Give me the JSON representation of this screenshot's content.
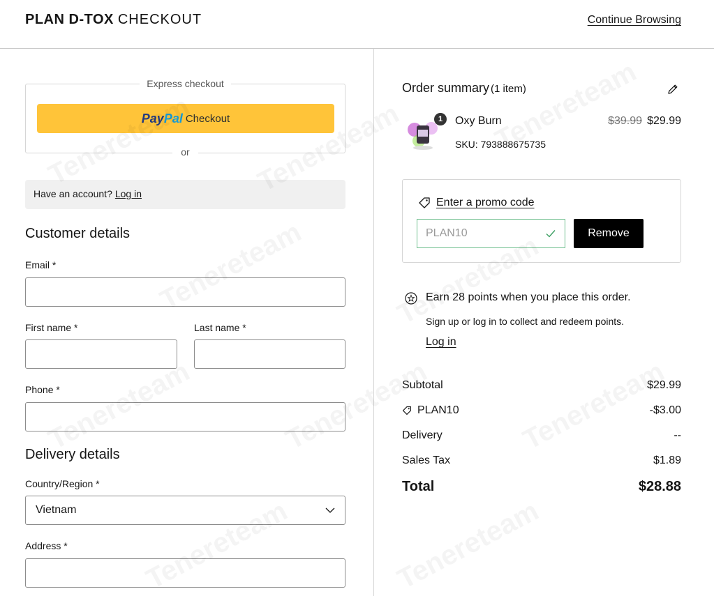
{
  "header": {
    "brand_name": "PLAN D-TOX",
    "brand_sub": "CHECKOUT",
    "continue_label": "Continue Browsing"
  },
  "express": {
    "title": "Express checkout",
    "paypal_pay": "Pay",
    "paypal_pal": "Pal",
    "paypal_text": "Checkout",
    "or": "or"
  },
  "account": {
    "prompt": "Have an account?",
    "login": "Log in"
  },
  "customer": {
    "title": "Customer details",
    "email_label": "Email *",
    "email_value": "",
    "first_name_label": "First name *",
    "first_name_value": "",
    "last_name_label": "Last name *",
    "last_name_value": "",
    "phone_label": "Phone *",
    "phone_value": ""
  },
  "delivery": {
    "title": "Delivery details",
    "country_label": "Country/Region *",
    "country_value": "Vietnam",
    "address_label": "Address *",
    "address_value": ""
  },
  "summary": {
    "title": "Order summary",
    "count": "(1 item)",
    "item": {
      "quantity": "1",
      "name": "Oxy Burn",
      "sku": "SKU: 793888675735",
      "price_old": "$39.99",
      "price_new": "$29.99"
    },
    "promo": {
      "link": "Enter a promo code",
      "code": "PLAN10",
      "remove": "Remove"
    },
    "points": {
      "title": "Earn 28 points when you place this order.",
      "sub": "Sign up or log in to collect and redeem points.",
      "login": "Log in"
    },
    "totals": {
      "subtotal_label": "Subtotal",
      "subtotal_value": "$29.99",
      "discount_label": "PLAN10",
      "discount_value": "-$3.00",
      "delivery_label": "Delivery",
      "delivery_value": "--",
      "tax_label": "Sales Tax",
      "tax_value": "$1.89",
      "total_label": "Total",
      "total_value": "$28.88"
    }
  },
  "colors": {
    "paypal_yellow": "#ffc439",
    "paypal_blue_dark": "#253b80",
    "paypal_blue_light": "#179bd7",
    "promo_valid_green": "#6fbf8e",
    "remove_button_bg": "#000000"
  },
  "watermark": "Tenereteam"
}
